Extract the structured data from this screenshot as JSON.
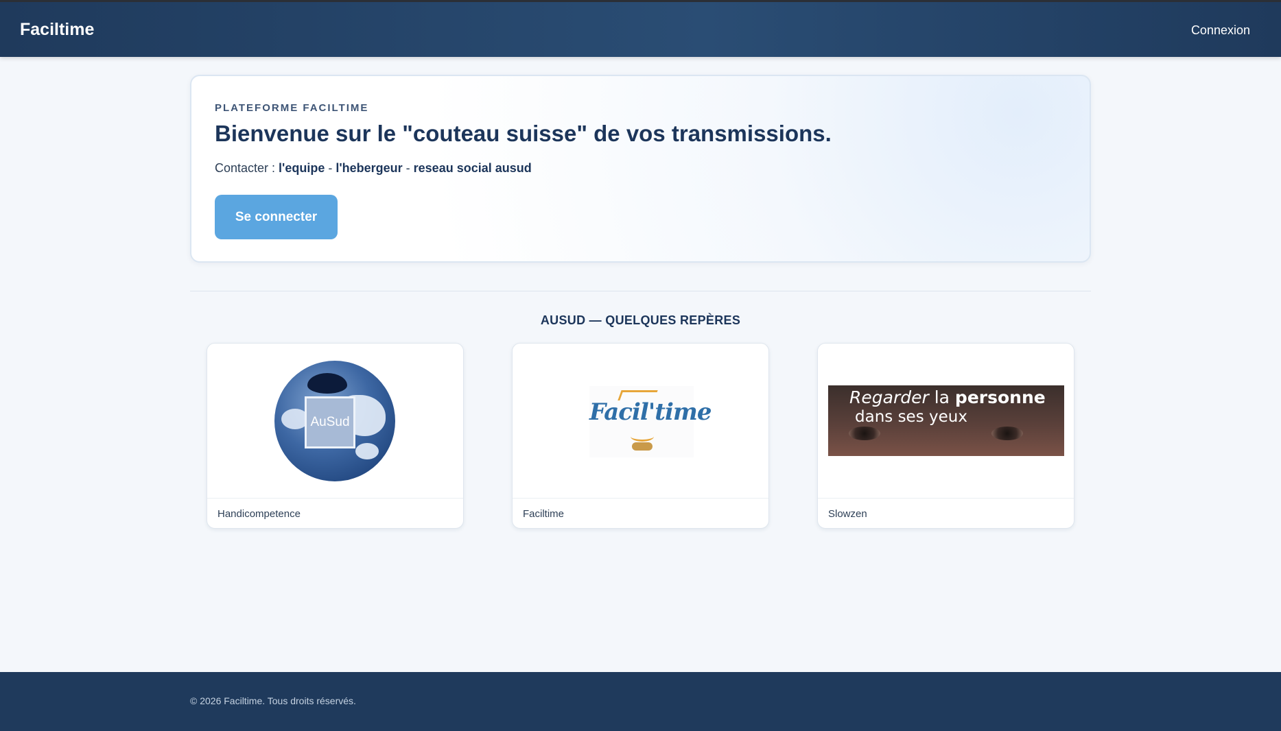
{
  "header": {
    "brand": "Faciltime",
    "login_link": "Connexion"
  },
  "hero": {
    "eyebrow": "PLATEFORME FACILTIME",
    "title": "Bienvenue sur le \"couteau suisse\" de vos transmissions.",
    "contact_prefix": "Contacter : ",
    "contact_links": [
      "l'equipe",
      "l'hebergeur",
      "reseau social ausud"
    ],
    "contact_separator": " - ",
    "cta_label": "Se connecter"
  },
  "section": {
    "title": "AUSUD — QUELQUES REPÈRES"
  },
  "cards": [
    {
      "label": "Handicompetence",
      "logo_text": "AuSud",
      "icon": "globe-logo"
    },
    {
      "label": "Faciltime",
      "logo_text": "Facil'time",
      "icon": "faciltime-logo"
    },
    {
      "label": "Slowzen",
      "banner_italic": "Regarder",
      "banner_plain": "la",
      "banner_bold": "personne",
      "banner_line2": "dans ses yeux",
      "icon": "eyes-banner"
    }
  ],
  "footer": {
    "text": "© 2026 Faciltime. Tous droits réservés."
  },
  "colors": {
    "header_bg": "#1f3a5c",
    "accent_button": "#5ba6e0",
    "heading": "#1c355a",
    "page_bg": "#f4f7fb"
  }
}
